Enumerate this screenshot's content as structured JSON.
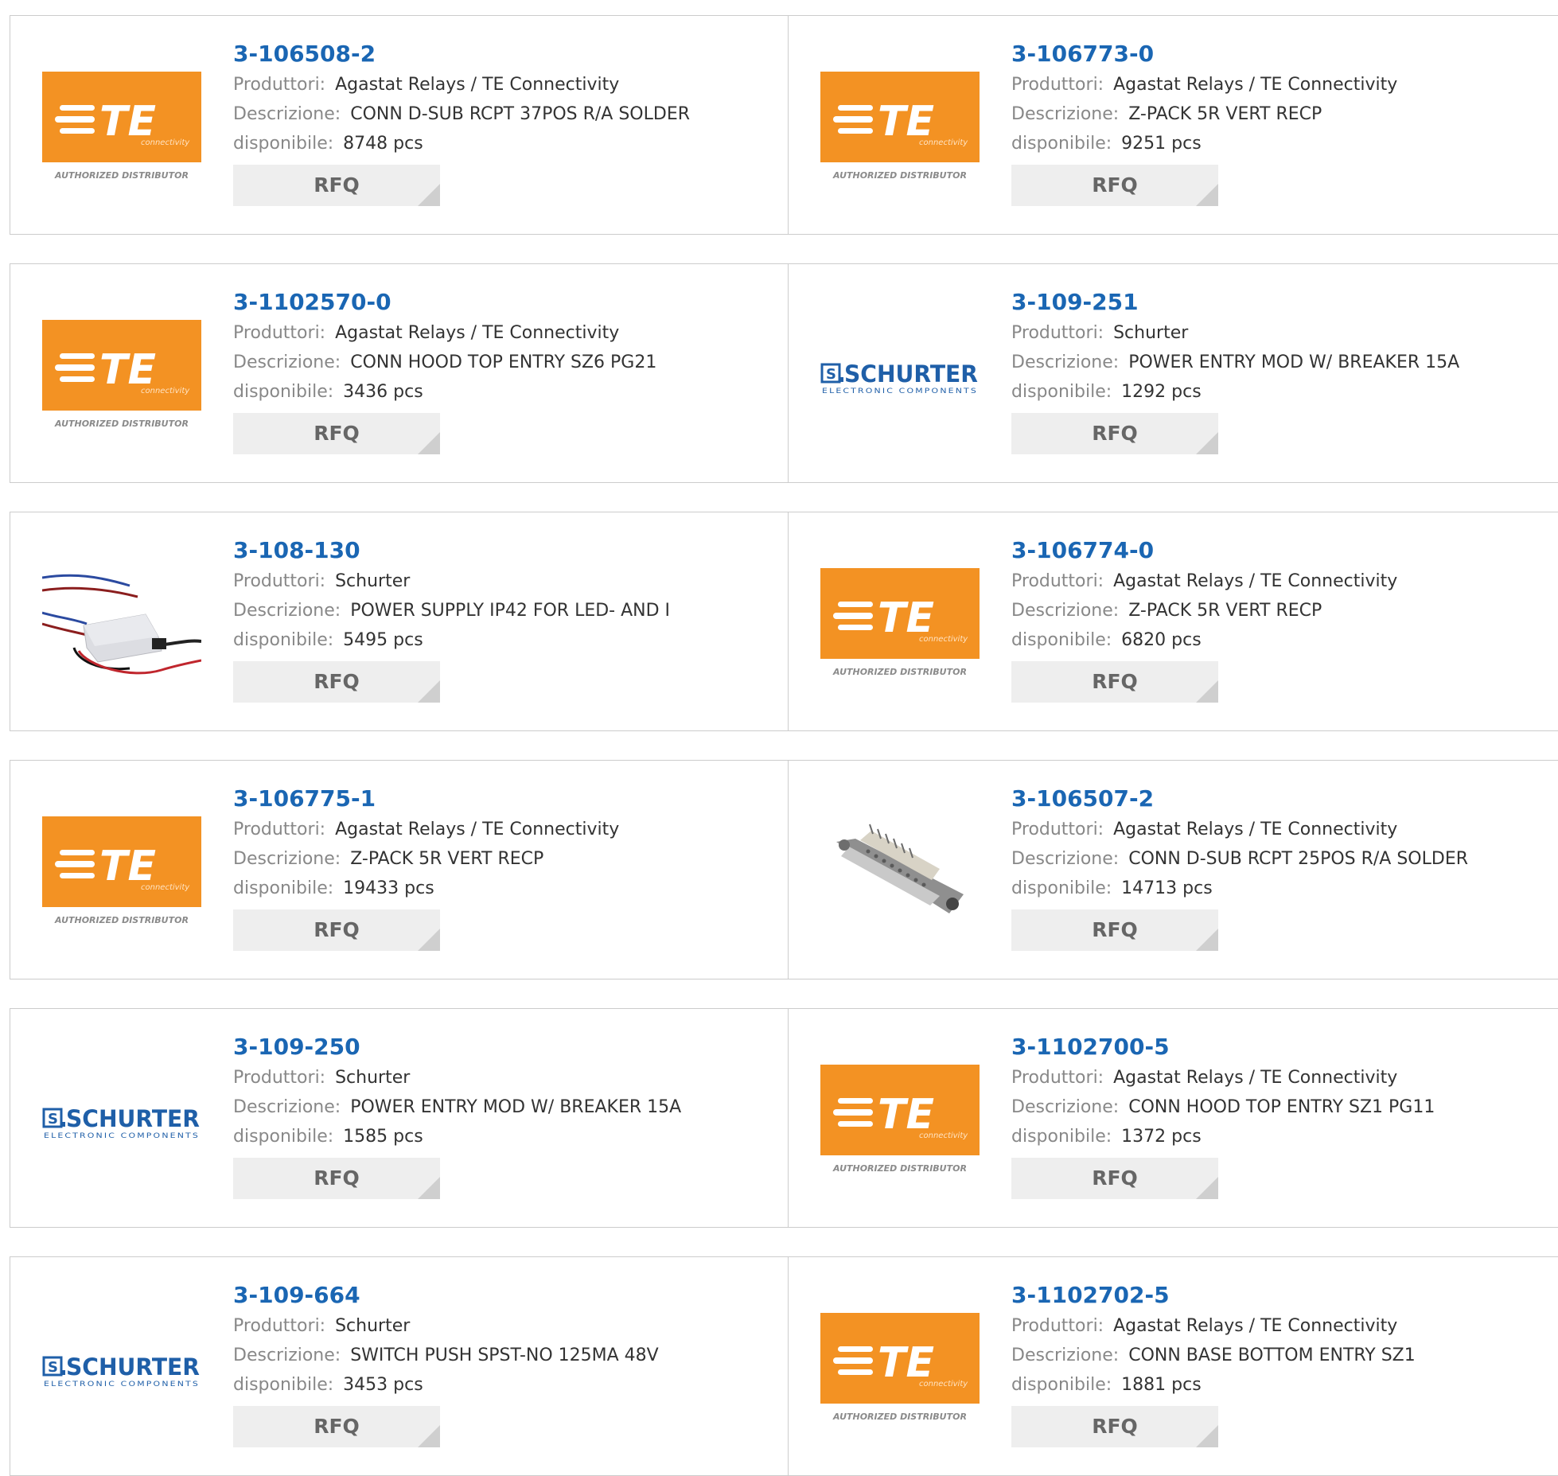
{
  "labels": {
    "manufacturer": "Produttori:",
    "description": "Descrizione:",
    "available": "disponibile:",
    "rfq": "RFQ"
  },
  "logos": {
    "te": {
      "brand": "TE",
      "sub": "connectivity",
      "tagline": "AUTHORIZED DISTRIBUTOR",
      "color": "#f39223"
    },
    "schurter": {
      "brand": "SCHURTER",
      "sub": "ELECTRONIC COMPONENTS",
      "color": "#1f5fa8"
    }
  },
  "products": [
    {
      "part": "3-106508-2",
      "manufacturer": "Agastat Relays / TE Connectivity",
      "description": "CONN D-SUB RCPT 37POS R/A SOLDER",
      "stock": "8748 pcs",
      "image": "te-logo"
    },
    {
      "part": "3-106773-0",
      "manufacturer": "Agastat Relays / TE Connectivity",
      "description": "Z-PACK 5R VERT RECP",
      "stock": "9251 pcs",
      "image": "te-logo"
    },
    {
      "part": "3-1102570-0",
      "manufacturer": "Agastat Relays / TE Connectivity",
      "description": "CONN HOOD TOP ENTRY SZ6 PG21",
      "stock": "3436 pcs",
      "image": "te-logo"
    },
    {
      "part": "3-109-251",
      "manufacturer": "Schurter",
      "description": "POWER ENTRY MOD W/ BREAKER 15A",
      "stock": "1292 pcs",
      "image": "schurter-logo"
    },
    {
      "part": "3-108-130",
      "manufacturer": "Schurter",
      "description": "POWER SUPPLY IP42 FOR LED- AND I",
      "stock": "5495 pcs",
      "image": "power-supply-photo"
    },
    {
      "part": "3-106774-0",
      "manufacturer": "Agastat Relays / TE Connectivity",
      "description": "Z-PACK 5R VERT RECP",
      "stock": "6820 pcs",
      "image": "te-logo"
    },
    {
      "part": "3-106775-1",
      "manufacturer": "Agastat Relays / TE Connectivity",
      "description": "Z-PACK 5R VERT RECP",
      "stock": "19433 pcs",
      "image": "te-logo"
    },
    {
      "part": "3-106507-2",
      "manufacturer": "Agastat Relays / TE Connectivity",
      "description": "CONN D-SUB RCPT 25POS R/A SOLDER",
      "stock": "14713 pcs",
      "image": "dsub-connector-photo"
    },
    {
      "part": "3-109-250",
      "manufacturer": "Schurter",
      "description": "POWER ENTRY MOD W/ BREAKER 15A",
      "stock": "1585 pcs",
      "image": "schurter-logo"
    },
    {
      "part": "3-1102700-5",
      "manufacturer": "Agastat Relays / TE Connectivity",
      "description": "CONN HOOD TOP ENTRY SZ1 PG11",
      "stock": "1372 pcs",
      "image": "te-logo"
    },
    {
      "part": "3-109-664",
      "manufacturer": "Schurter",
      "description": "SWITCH PUSH SPST-NO 125MA 48V",
      "stock": "3453 pcs",
      "image": "schurter-logo"
    },
    {
      "part": "3-1102702-5",
      "manufacturer": "Agastat Relays / TE Connectivity",
      "description": "CONN BASE BOTTOM ENTRY SZ1",
      "stock": "1881 pcs",
      "image": "te-logo"
    }
  ]
}
